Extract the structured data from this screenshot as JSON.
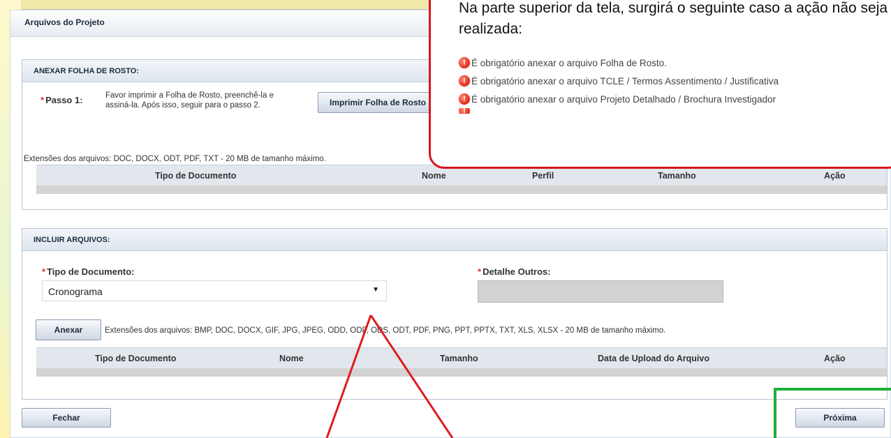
{
  "window": {
    "title": "Arquivos do Projeto"
  },
  "callout": {
    "text": "Na parte superior da tela, surgirá o seguinte caso a ação não seja realizada:",
    "errors": [
      "É obrigatório anexar o arquivo Folha de Rosto.",
      "É obrigatório anexar o arquivo TCLE / Termos Assentimento / Justificativa",
      "É obrigatório anexar o arquivo Projeto Detalhado / Brochura Investigador"
    ],
    "border_color": "#d9141b"
  },
  "folha_rosto": {
    "title": "ANEXAR FOLHA DE ROSTO:",
    "step_label": "Passo 1:",
    "step_text": "Favor imprimir a Folha de Rosto, preenchê-la e assiná-la. Após isso, seguir para o passo 2.",
    "print_button": "Imprimir Folha de Rosto",
    "extensions": "Extensões dos arquivos: DOC, DOCX, ODT, PDF, TXT - 20 MB de tamanho máximo.",
    "columns": [
      "Tipo de Documento",
      "Nome",
      "Perfil",
      "Tamanho",
      "Ação"
    ]
  },
  "incluir": {
    "title": "INCLUIR ARQUIVOS:",
    "tipo_label": "Tipo de Documento:",
    "tipo_value": "Cronograma",
    "detalhe_label": "Detalhe Outros:",
    "detalhe_value": "",
    "anexar_button": "Anexar",
    "extensions": "Extensões dos arquivos: BMP, DOC, DOCX, GIF, JPG, JPEG, ODD, ODP, ODS, ODT, PDF, PNG, PPT, PPTX, TXT, XLS, XLSX - 20 MB de tamanho máximo.",
    "columns": [
      "Tipo de Documento",
      "Nome",
      "Tamanho",
      "Data de Upload do Arquivo",
      "Ação"
    ]
  },
  "footer": {
    "close_button": "Fechar",
    "next_button": "Próxima"
  },
  "colors": {
    "highlight_green": "#1fae3b",
    "annotation_red": "#e01b1b"
  }
}
